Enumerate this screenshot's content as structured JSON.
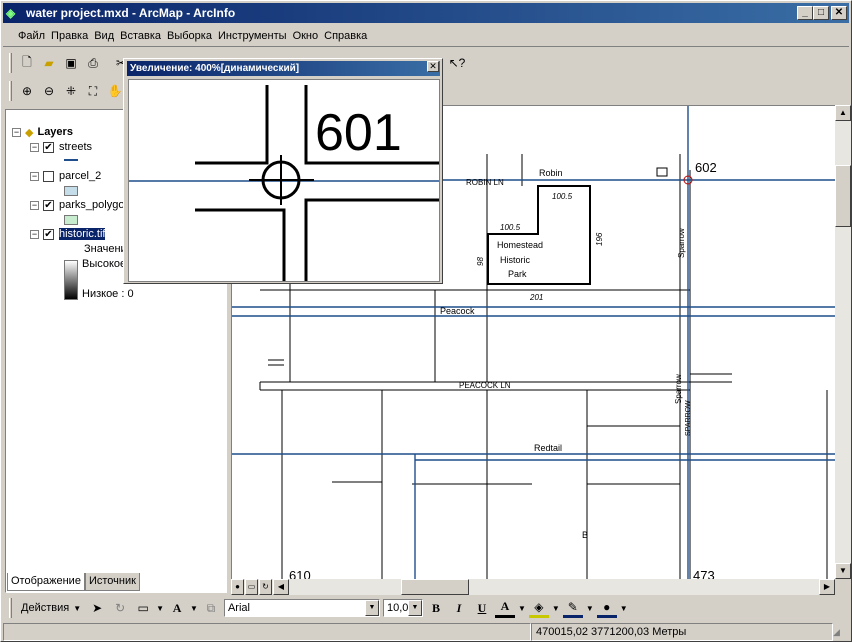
{
  "window": {
    "title": "water project.mxd - ArcMap - ArcInfo",
    "min": "_",
    "max": "□",
    "close": "✕"
  },
  "menu": [
    "Файл",
    "Правка",
    "Вид",
    "Вставка",
    "Выборка",
    "Инструменты",
    "Окно",
    "Справка"
  ],
  "toc": {
    "root": "Layers",
    "layers": [
      {
        "name": "streets",
        "checked": "✔"
      },
      {
        "name": "parcel_2",
        "checked": ""
      },
      {
        "name": "parks_polygo",
        "checked": "✔"
      },
      {
        "name": "historic.tif",
        "checked": "✔"
      }
    ],
    "legend": {
      "header": "Значени",
      "high": "Высокое",
      "low": "Низкое : 0"
    },
    "tabs": [
      "Отображение",
      "Источник"
    ]
  },
  "magnifier": {
    "title": "Увеличение: 400%[динамический]",
    "close": "✕",
    "label": "601"
  },
  "map": {
    "labels": {
      "robin": "Robin",
      "robin_ln": "ROBIN LN",
      "peacock": "Peacock",
      "peacock_ln": "PEACOCK LN",
      "redtail": "Redtail",
      "sparrow": "Sparrow",
      "sparrow2": "Sparrow",
      "sparrow_vert": "SPARROW",
      "historic_1": "Homestead",
      "historic_2": "Historic",
      "historic_3": "Park",
      "dim_1005a": "100.5",
      "dim_1005b": "100.5",
      "dim_201": "201",
      "dim_196": "196",
      "dim_98": "98",
      "n602": "602",
      "n610": "610",
      "n473": "473",
      "b": "B"
    }
  },
  "draw": {
    "actions": "Действия",
    "font": "Arial",
    "size": "10,0",
    "bold": "B",
    "italic": "I",
    "underline": "U",
    "fontcolor": "A"
  },
  "status": {
    "coords": "470015,02  3771200,03 Метры"
  }
}
